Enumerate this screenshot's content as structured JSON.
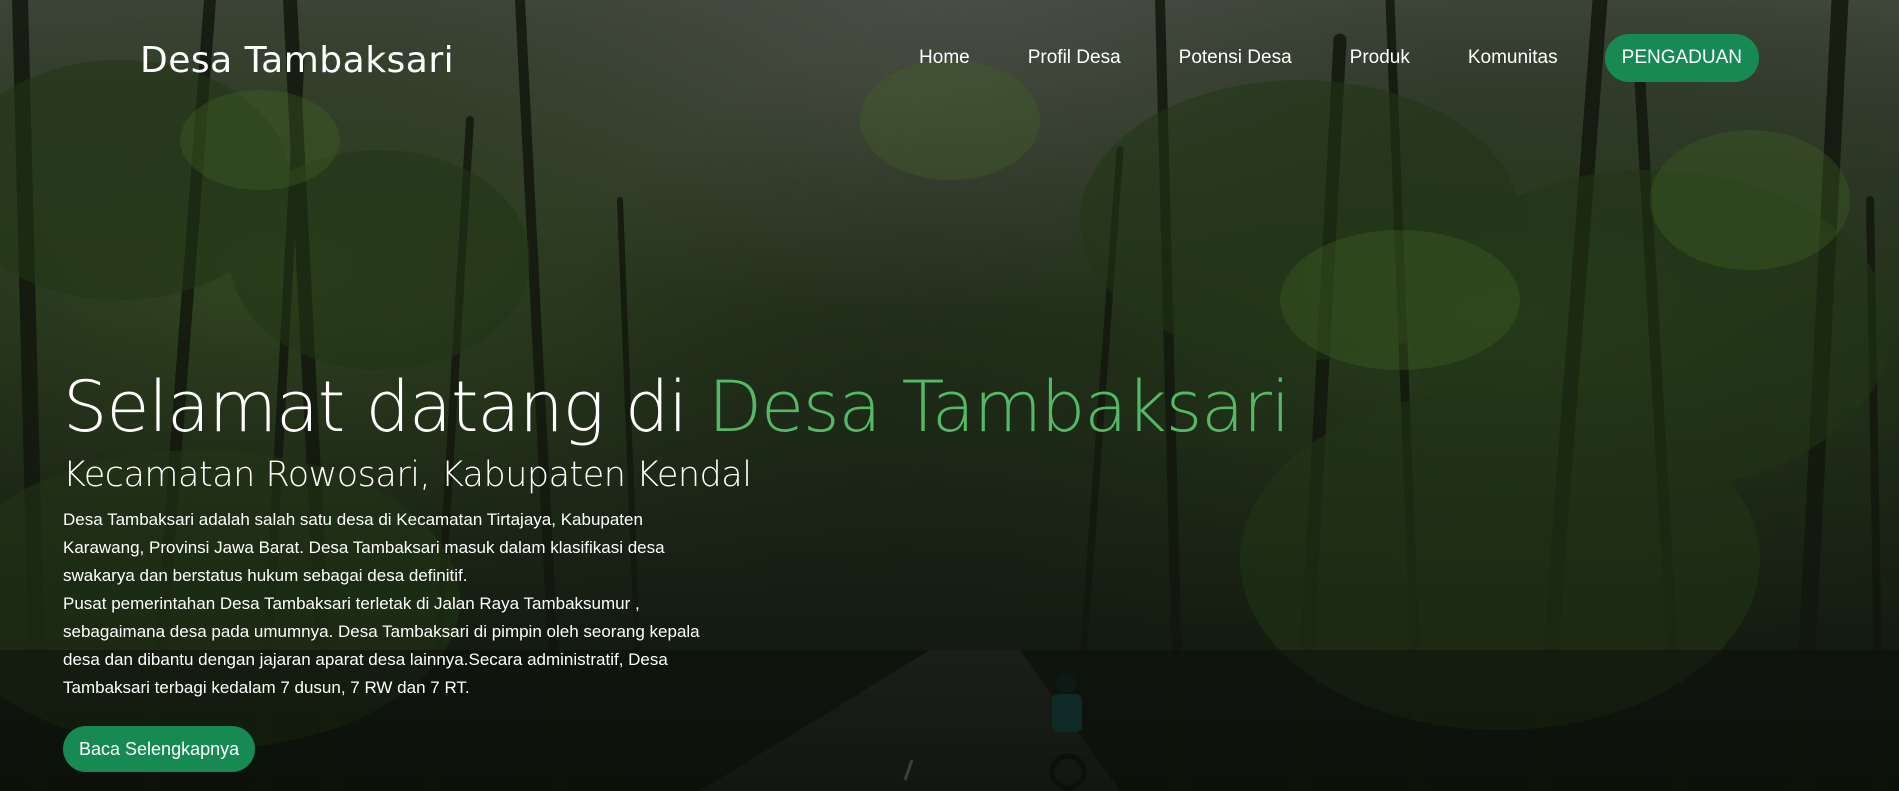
{
  "colors": {
    "accent": "#55b868",
    "button": "#178a54"
  },
  "brand": "Desa Tambaksari",
  "nav": {
    "items": [
      {
        "label": "Home"
      },
      {
        "label": "Profil Desa"
      },
      {
        "label": "Potensi Desa"
      },
      {
        "label": "Produk"
      },
      {
        "label": "Komunitas"
      }
    ],
    "cta_label": "PENGADUAN"
  },
  "hero": {
    "title_prefix": "Selamat datang di ",
    "title_highlight": "Desa Tambaksari",
    "subtitle": "Kecamatan Rowosari, Kabupaten Kendal",
    "paragraph1": "Desa Tambaksari adalah salah satu desa di Kecamatan Tirtajaya, Kabupaten Karawang, Provinsi Jawa Barat. Desa Tambaksari masuk dalam klasifikasi desa swakarya dan berstatus hukum sebagai desa definitif.",
    "paragraph2": "Pusat pemerintahan Desa Tambaksari terletak di Jalan Raya Tambaksumur , sebagaimana desa pada umumnya. Desa Tambaksari di pimpin oleh seorang kepala desa dan dibantu dengan jajaran aparat desa lainnya.Secara administratif, Desa Tambaksari terbagi kedalam 7 dusun, 7 RW dan 7 RT.",
    "button_label": "Baca Selengkapnya"
  }
}
